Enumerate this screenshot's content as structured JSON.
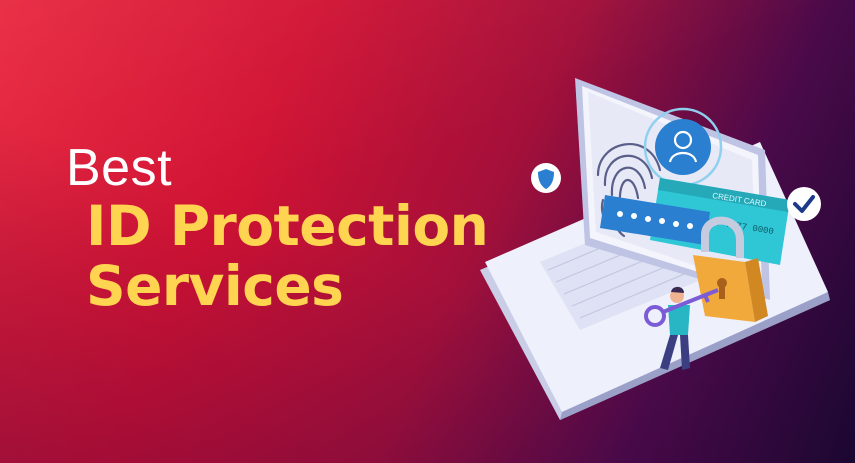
{
  "banner": {
    "line1": "Best",
    "line2": "ID Protection",
    "line3": "Services"
  },
  "card": {
    "label": "CREDIT CARD",
    "number": "5745 7230 7277 0000"
  },
  "colors": {
    "title_white": "#ffffff",
    "title_yellow": "#ffd451",
    "background_red": "#d11233",
    "background_dark": "#1a0730",
    "accent_teal": "#2fc7d6",
    "lock_gold": "#f2a93b"
  },
  "icons": [
    "shield-badge-icon",
    "checkmark-badge-icon",
    "fingerprint-icon",
    "user-avatar-icon",
    "padlock-icon",
    "key-icon"
  ]
}
